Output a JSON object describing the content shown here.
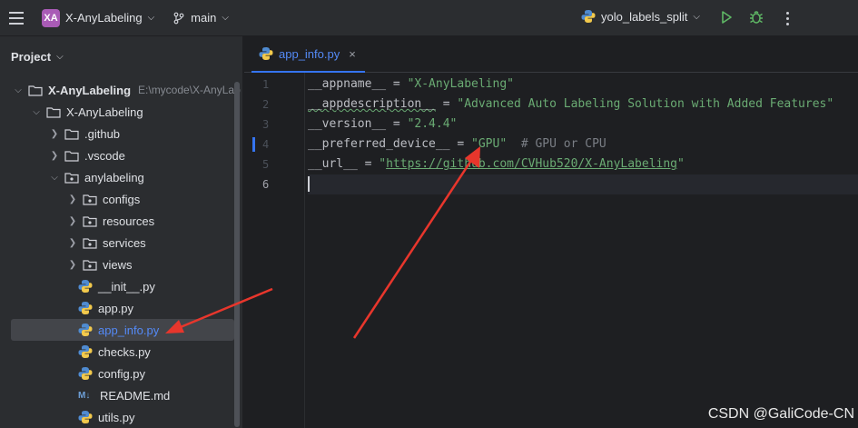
{
  "topbar": {
    "project_badge": "XA",
    "project_name": "X-AnyLabeling",
    "branch": "main",
    "run_config": "yolo_labels_split",
    "icons": [
      "hamburger-menu-icon",
      "branch-icon",
      "python-icon",
      "run-icon",
      "debug-icon",
      "more-icon"
    ]
  },
  "sidebar": {
    "title": "Project",
    "tree": [
      {
        "label": "X-AnyLabeling",
        "path": "E:\\mycode\\X-AnyLab",
        "kind": "folder",
        "expanded": true
      },
      {
        "label": "X-AnyLabeling",
        "kind": "folder",
        "expanded": true
      },
      {
        "label": ".github",
        "kind": "folder",
        "expanded": false
      },
      {
        "label": ".vscode",
        "kind": "folder",
        "expanded": false
      },
      {
        "label": "anylabeling",
        "kind": "package",
        "expanded": true
      },
      {
        "label": "configs",
        "kind": "package",
        "expanded": false
      },
      {
        "label": "resources",
        "kind": "package",
        "expanded": false
      },
      {
        "label": "services",
        "kind": "package",
        "expanded": false
      },
      {
        "label": "views",
        "kind": "package",
        "expanded": false
      },
      {
        "label": "__init__.py",
        "kind": "python"
      },
      {
        "label": "app.py",
        "kind": "python"
      },
      {
        "label": "app_info.py",
        "kind": "python",
        "selected": true
      },
      {
        "label": "checks.py",
        "kind": "python"
      },
      {
        "label": "config.py",
        "kind": "python"
      },
      {
        "label": "README.md",
        "kind": "markdown",
        "md_badge": "M↓"
      },
      {
        "label": "utils.py",
        "kind": "python"
      }
    ]
  },
  "editor": {
    "tab_label": "app_info.py",
    "tab_close": "×",
    "line_numbers": [
      "1",
      "2",
      "3",
      "4",
      "5",
      "6"
    ],
    "lines": {
      "l1_name": "__appname__",
      "l1_eq": " = ",
      "l1_val": "\"X-AnyLabeling\"",
      "l2_name": "__appdescription__",
      "l2_eq": " = ",
      "l2_val": "\"Advanced Auto Labeling Solution with Added Features\"",
      "l3_name": "__version__",
      "l3_eq": " = ",
      "l3_val": "\"2.4.4\"",
      "l4_name": "__preferred_device__",
      "l4_eq": " = ",
      "l4_val": "\"GPU\"",
      "l4_comment": "  # GPU or CPU",
      "l5_name": "__url__",
      "l5_eq": " = ",
      "l5_q1": "\"",
      "l5_url": "https://github.com/CVHub520/X-AnyLabeling",
      "l5_q2": "\""
    }
  },
  "annotation_color": "#e8362c",
  "watermark": "CSDN @GaliCode-CN"
}
